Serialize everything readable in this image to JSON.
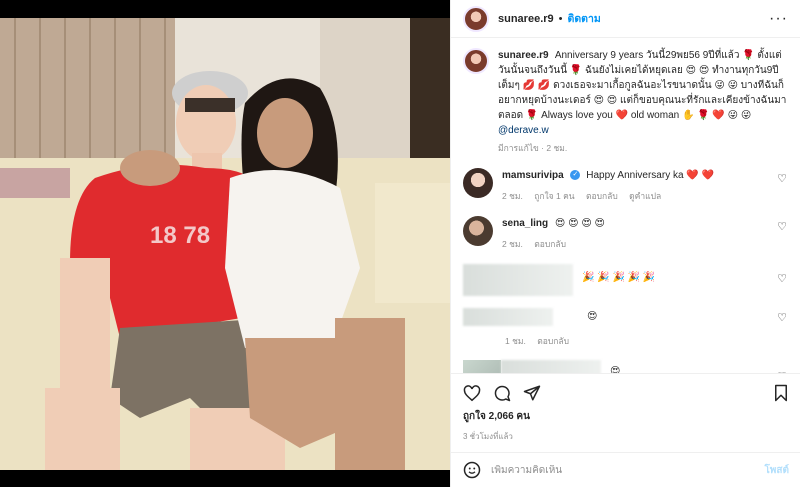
{
  "post": {
    "author": "sunaree.r9",
    "separator": "•",
    "follow_label": "ติดตาม",
    "more_label": "···",
    "caption": {
      "username": "sunaree.r9",
      "text": "Anniversary 9 years วันนี้29พย56 9ปีที่แล้ว 🌹 ตั้งแต่วันนั้นจนถึงวันนี้ 🌹 ฉันยังไม่เคยได้หยุดเลย 😍 😍 ทำงานทุกวัน9ปีเต็มๆ 💋 💋 ดวงเธอจะมาเกื้อกูลฉันอะไรขนาดนั้น 😜 😜 บางทีฉันก็อยากหยุดบ้างนะเดอร์ 😍 😍 แต่ก็ขอบคุณนะที่รักและเคียงข้างฉันมาตลอด 🌹 Always love you ❤️ old woman ✋ 🌹 ❤️ 😜 😜",
      "mention": "@derave.w",
      "meta": "มีการแก้ไข · 2 ชม."
    },
    "comments": [
      {
        "username": "mamsurivipa",
        "verified_mark": "✓",
        "text": "Happy Anniversary ka ❤️ ❤️",
        "time": "2 ชม.",
        "likes": "ถูกใจ 1 คน",
        "reply": "ตอบกลับ",
        "translate": "ดูคำแปล"
      },
      {
        "username": "sena_ling",
        "text": "😍 😍 😍 😍",
        "time": "2 ชม.",
        "reply": "ตอบกลับ"
      },
      {
        "text": "🎉 🎉 🎉 🎉 🎉"
      },
      {
        "text": "😍",
        "time": "1 ชม.",
        "reply": "ตอบกลับ"
      },
      {
        "text": "😍"
      }
    ],
    "likes_count": "ถูกใจ 2,066 คน",
    "posted_ago": "3 ชั่วโมงที่แล้ว",
    "add_comment_placeholder": "เพิ่มความคิดเห็น",
    "post_button": "โพสต์",
    "icons": {
      "like": "heart-icon",
      "comment": "comment-icon",
      "share": "share-icon",
      "save": "bookmark-icon",
      "emoji": "emoji-icon"
    }
  }
}
